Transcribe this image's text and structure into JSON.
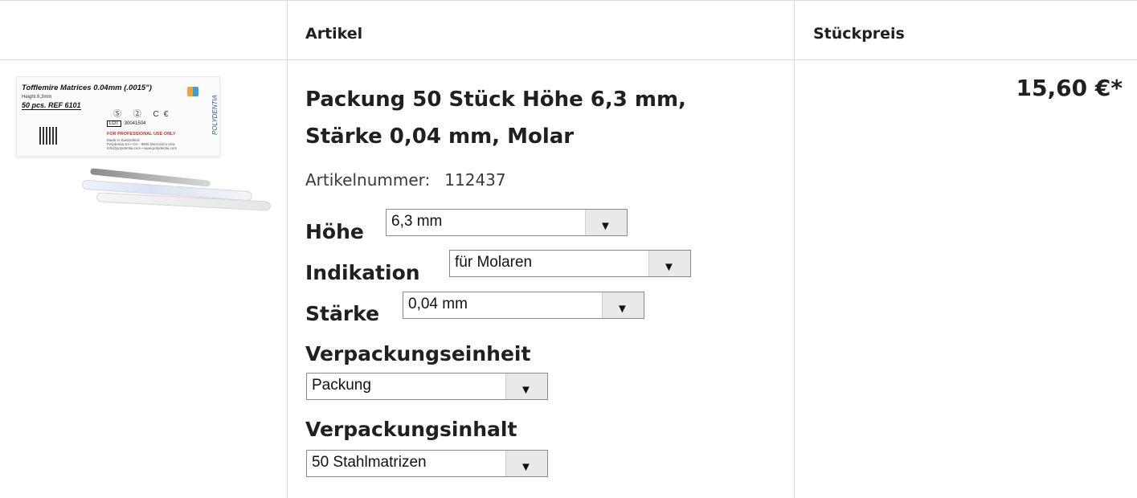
{
  "table": {
    "header": {
      "article": "Artikel",
      "unit_price": "Stückpreis"
    }
  },
  "product": {
    "image": {
      "box_title": "Tofflemire Matrices 0.04mm (.0015\")",
      "height_line": "Height 6,3mm",
      "pcs_ref": "50 pcs.   REF 6101",
      "lot_label": "LOT",
      "lot_number": "30041504",
      "professional": "FOR PROFESSIONAL USE ONLY",
      "made_in": "Made in Switzerland",
      "address": "Polydentia SA • CH - 6805 Mezzovico-Vira",
      "web": "info@polydentia.com • www.polydentia.com",
      "brand": "POLYDENTIA"
    },
    "title": "Packung 50 Stück Höhe 6,3 mm, Stärke 0,04 mm, Molar",
    "article_number_label": "Artikelnummer:",
    "article_number": "112437",
    "price": "15,60 €*"
  },
  "options": {
    "height": {
      "label": "Höhe",
      "value": "6,3 mm"
    },
    "indication": {
      "label": "Indikation",
      "value": "für Molaren"
    },
    "thickness": {
      "label": "Stärke",
      "value": "0,04 mm"
    },
    "packaging_unit": {
      "label": "Verpackungseinheit",
      "value": "Packung"
    },
    "packaging_content": {
      "label": "Verpackungsinhalt",
      "value": "50 Stahlmatrizen"
    }
  },
  "icons": {
    "dropdown": "chevron-down-icon"
  }
}
